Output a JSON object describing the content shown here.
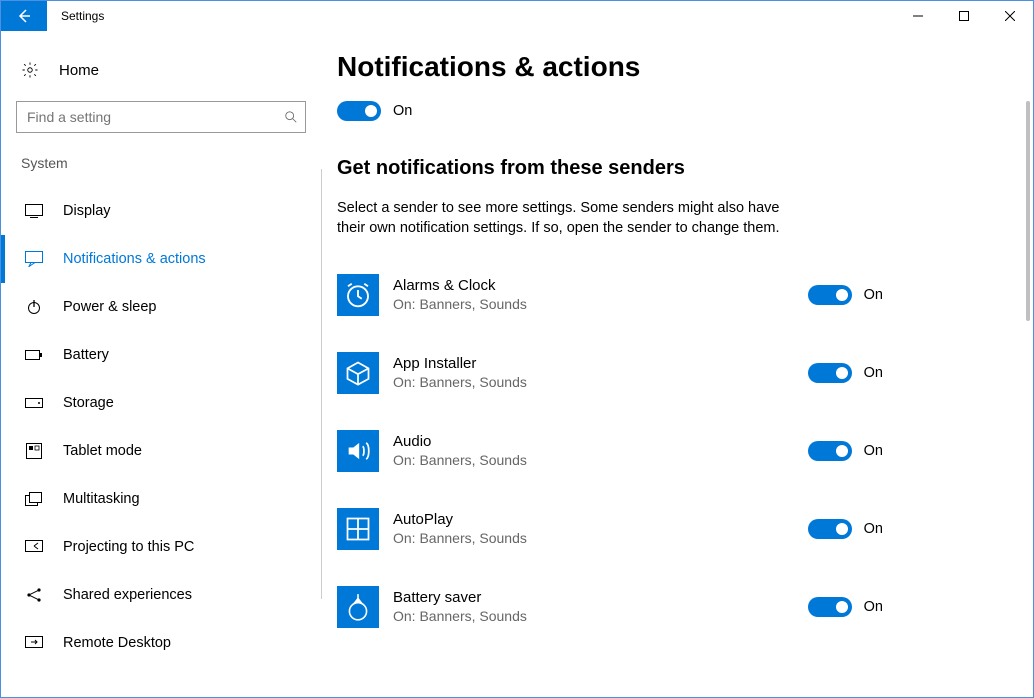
{
  "window": {
    "app_title": "Settings"
  },
  "sidebar": {
    "home_label": "Home",
    "search_placeholder": "Find a setting",
    "section_label": "System",
    "items": [
      {
        "label": "Display"
      },
      {
        "label": "Notifications & actions"
      },
      {
        "label": "Power & sleep"
      },
      {
        "label": "Battery"
      },
      {
        "label": "Storage"
      },
      {
        "label": "Tablet mode"
      },
      {
        "label": "Multitasking"
      },
      {
        "label": "Projecting to this PC"
      },
      {
        "label": "Shared experiences"
      },
      {
        "label": "Remote Desktop"
      }
    ]
  },
  "main": {
    "title": "Notifications & actions",
    "master_toggle_label": "On",
    "senders_heading": "Get notifications from these senders",
    "description": "Select a sender to see more settings. Some senders might also have their own notification settings. If so, open the sender to change them.",
    "senders": [
      {
        "name": "Alarms & Clock",
        "status": "On: Banners, Sounds",
        "toggle_label": "On"
      },
      {
        "name": "App Installer",
        "status": "On: Banners, Sounds",
        "toggle_label": "On"
      },
      {
        "name": "Audio",
        "status": "On: Banners, Sounds",
        "toggle_label": "On"
      },
      {
        "name": "AutoPlay",
        "status": "On: Banners, Sounds",
        "toggle_label": "On"
      },
      {
        "name": "Battery saver",
        "status": "On: Banners, Sounds",
        "toggle_label": "On"
      }
    ]
  }
}
